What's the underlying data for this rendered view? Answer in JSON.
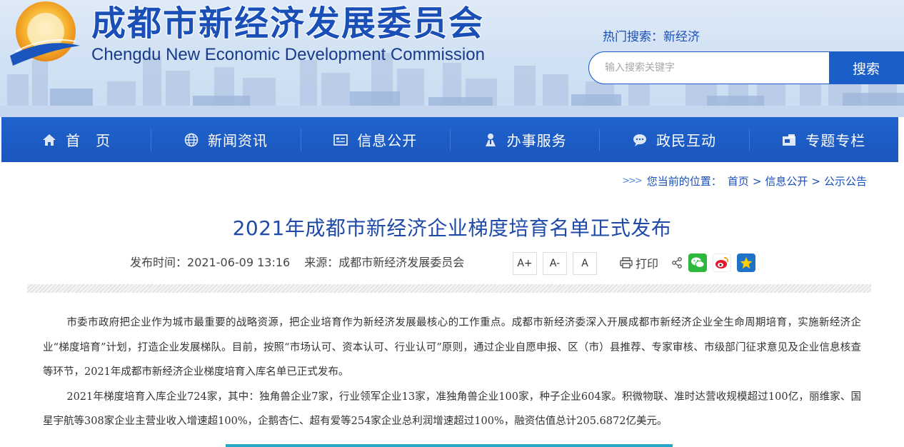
{
  "header": {
    "title_cn": "成都市新经济发展委员会",
    "title_en": "Chengdu New Economic Development Commission",
    "hot_search": "热门搜索：新经济",
    "search_placeholder": "输入搜索关键字",
    "search_button": "搜索"
  },
  "nav": {
    "items": [
      {
        "label": "首　页",
        "icon": "home-icon"
      },
      {
        "label": "新闻资讯",
        "icon": "globe-icon"
      },
      {
        "label": "信息公开",
        "icon": "document-list-icon"
      },
      {
        "label": "办事服务",
        "icon": "person-icon"
      },
      {
        "label": "政民互动",
        "icon": "chat-bubble-icon"
      },
      {
        "label": "专题专栏",
        "icon": "folder-icon"
      }
    ]
  },
  "breadcrumb": {
    "prefix": "您当前的位置：",
    "items": [
      "首页",
      "信息公开",
      "公示公告"
    ],
    "separator": ">"
  },
  "article": {
    "title": "2021年成都市新经济企业梯度培育名单正式发布",
    "publish_label": "发布时间：",
    "publish_time": "2021-06-09 13:16",
    "source_label": "来源：",
    "source": "成都市新经济发展委员会",
    "font_buttons": [
      "A+",
      "A-",
      "A"
    ],
    "print_label": "打印",
    "paragraphs": [
      "市委市政府把企业作为城市最重要的战略资源，把企业培育作为新经济发展最核心的工作重点。成都市新经济委深入开展成都市新经济企业全生命周期培育，实施新经济企业“梯度培育”计划，打造企业发展梯队。目前，按照“市场认可、资本认可、行业认可”原则，通过企业自愿申报、区（市）县推荐、专家审核、市级部门征求意见及企业信息核查等环节，2021年成都市新经济企业梯度培育入库名单已正式发布。",
      "2021年梯度培育入库企业724家，其中：独角兽企业7家，行业领军企业13家，准独角兽企业100家，种子企业604家。积微物联、准时达营收规模超过100亿，丽维家、国星宇航等308家企业主营业收入增速超100%，企鹅杏仁、超有爱等254家企业总利润增速超过100%，融资估值总计205.6872亿美元。"
    ]
  },
  "colors": {
    "brand_blue": "#1a56bd",
    "title_blue": "#1f4aa8",
    "accent_cyan": "#27a7c7"
  }
}
